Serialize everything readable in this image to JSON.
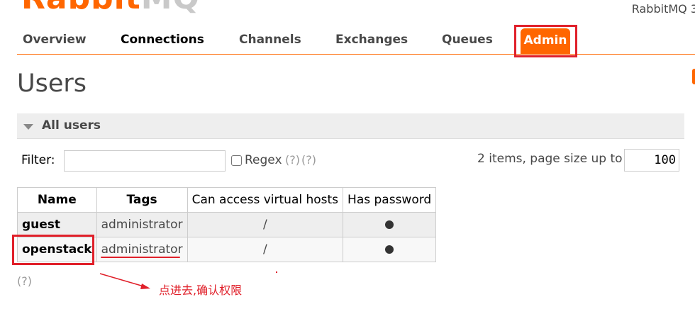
{
  "header": {
    "logo_text_orange": "Rabbit",
    "logo_text_grey": "MQ",
    "version_text": "RabbitMQ 3"
  },
  "nav": {
    "items": [
      {
        "label": "Overview"
      },
      {
        "label": "Connections"
      },
      {
        "label": "Channels"
      },
      {
        "label": "Exchanges"
      },
      {
        "label": "Queues"
      },
      {
        "label": "Admin",
        "active": true
      }
    ]
  },
  "page": {
    "title": "Users"
  },
  "section": {
    "title": "All users"
  },
  "filter": {
    "label": "Filter:",
    "value": "",
    "regex_label": "Regex",
    "help1": "(?)",
    "help2": "(?)",
    "items_text": "2 items, page size up to",
    "page_size": "100"
  },
  "table": {
    "headers": [
      "Name",
      "Tags",
      "Can access virtual hosts",
      "Has password"
    ],
    "rows": [
      {
        "name": "guest",
        "tags": "administrator",
        "vhosts": "/",
        "has_password": true
      },
      {
        "name": "openstack",
        "tags": "administrator",
        "vhosts": "/",
        "has_password": true
      }
    ]
  },
  "footer": {
    "help": "(?)"
  },
  "annotation": {
    "text": "点进去,确认权限"
  },
  "colors": {
    "accent": "#ff6600",
    "highlight": "#e0202a"
  }
}
